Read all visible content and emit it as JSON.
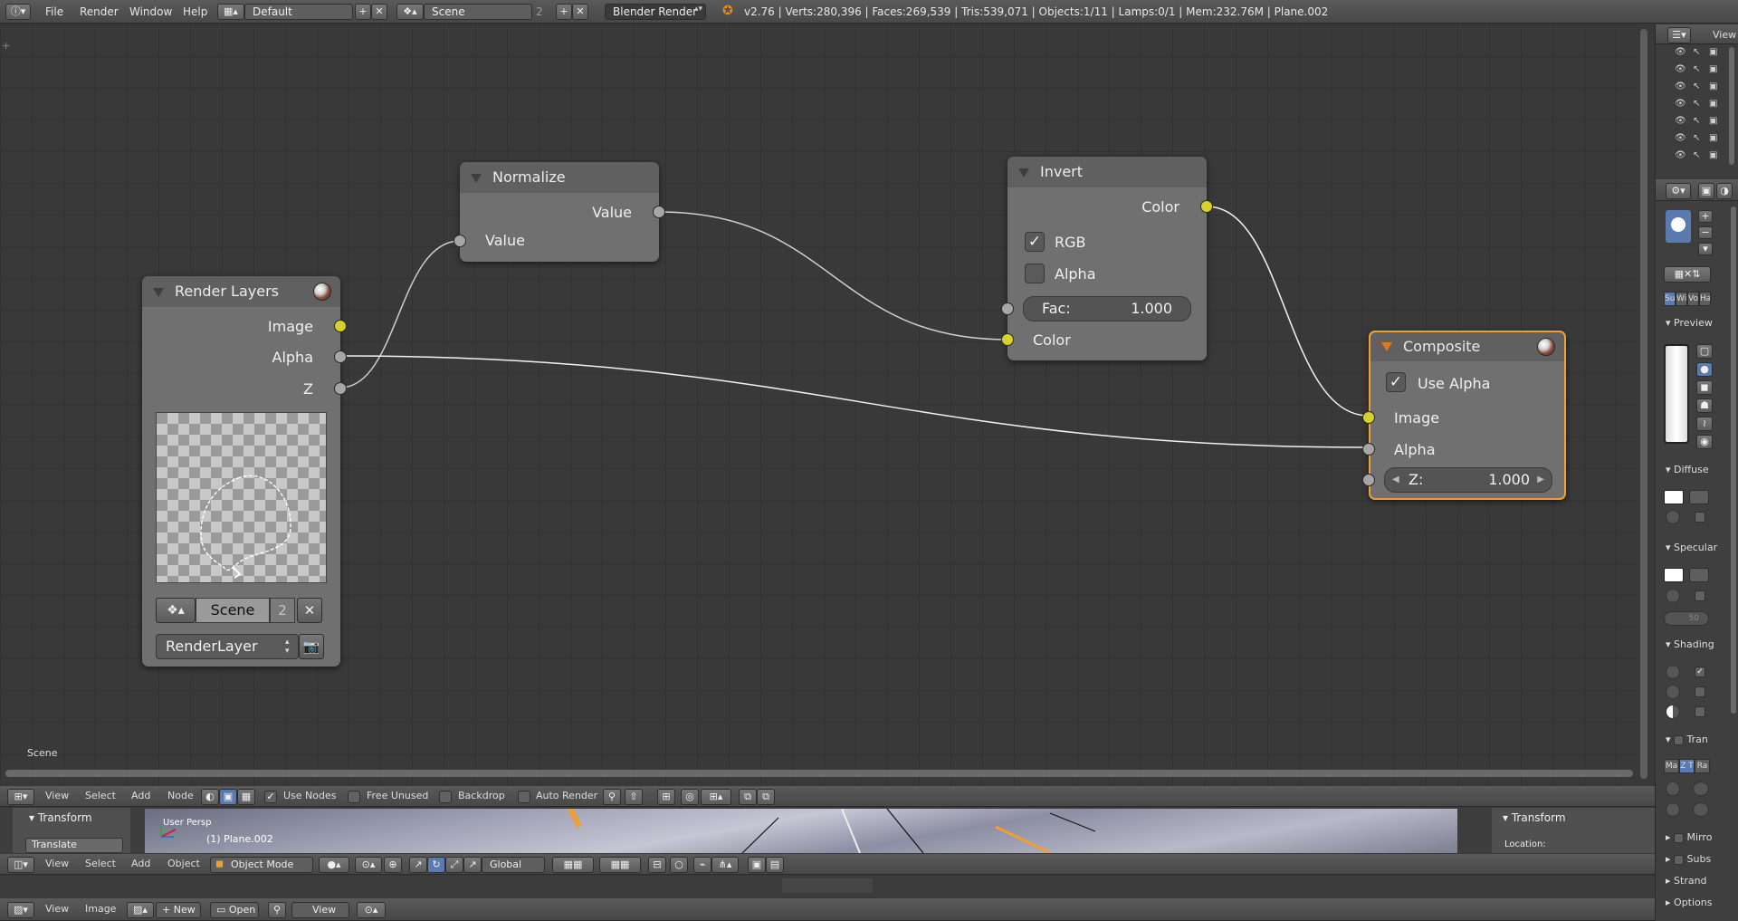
{
  "topbar": {
    "menus": [
      "File",
      "Render",
      "Window",
      "Help"
    ],
    "layout": "Default",
    "scene": "Scene",
    "scene_users": "2",
    "engine": "Blender Render",
    "stats": "v2.76 | Verts:280,396 | Faces:269,539 | Tris:539,071 | Objects:1/11 | Lamps:0/1 | Mem:232.76M | Plane.002"
  },
  "nodes": {
    "normalize": {
      "title": "Normalize",
      "out": "Value",
      "in": "Value"
    },
    "invert": {
      "title": "Invert",
      "out": "Color",
      "rgb": "RGB",
      "alpha": "Alpha",
      "fac_label": "Fac:",
      "fac_value": "1.000",
      "in": "Color"
    },
    "render_layers": {
      "title": "Render Layers",
      "out_image": "Image",
      "out_alpha": "Alpha",
      "out_z": "Z",
      "scene": "Scene",
      "scene_users": "2",
      "layer": "RenderLayer"
    },
    "composite": {
      "title": "Composite",
      "use_alpha": "Use Alpha",
      "in_image": "Image",
      "in_alpha": "Alpha",
      "z_label": "Z:",
      "z_value": "1.000"
    }
  },
  "editor_label": "Scene",
  "node_header": {
    "menus": [
      "View",
      "Select",
      "Add",
      "Node"
    ],
    "use_nodes": "Use Nodes",
    "free_unused": "Free Unused",
    "backdrop": "Backdrop",
    "auto_render": "Auto Render"
  },
  "viewport": {
    "left_panel": "Transform",
    "translate": "Translate",
    "persp": "User Persp",
    "object": "(1) Plane.002",
    "right_panel": "Transform",
    "location": "Location:"
  },
  "view3d_header": {
    "menus": [
      "View",
      "Select",
      "Add",
      "Object"
    ],
    "mode": "Object Mode",
    "orientation": "Global"
  },
  "image_header": {
    "menus": [
      "View",
      "Image"
    ],
    "new": "New",
    "open": "Open",
    "view": "View"
  },
  "outliner": {
    "label": "View"
  },
  "properties": {
    "preview": "Preview",
    "diffuse": "Diffuse",
    "specular": "Specular",
    "spec_hardness": "50",
    "shading": "Shading",
    "transparency": "Tran",
    "transp_tabs": [
      "Ma",
      "Z T",
      "Ra"
    ],
    "mirror": "Mirro",
    "subsurface": "Subs",
    "strand": "Strand",
    "options": "Options",
    "slot_tabs": [
      "Su",
      "Wi",
      "Vo",
      "Ha"
    ]
  },
  "colors": {
    "socket_yellow": "#d6d22a",
    "socket_grey": "#a6a6a6",
    "active_outline": "#f0a030",
    "grid_bg": "#393939"
  }
}
